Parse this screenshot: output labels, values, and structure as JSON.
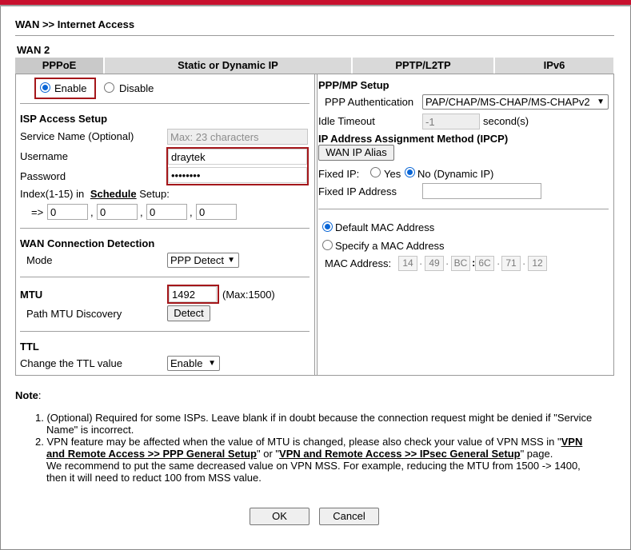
{
  "breadcrumb": "WAN >> Internet Access",
  "wan_label": "WAN 2",
  "tabs": [
    "PPPoE",
    "Static or Dynamic IP",
    "PPTP/L2TP",
    "IPv6"
  ],
  "enable_label": "Enable",
  "disable_label": "Disable",
  "isp": {
    "heading": "ISP Access Setup",
    "service_name_label": "Service Name (Optional)",
    "service_name_placeholder": "Max: 23 characters",
    "username_label": "Username",
    "username_value": "draytek",
    "password_label": "Password",
    "password_value": "••••••••",
    "index_label_pre": "Index(1-15) in",
    "schedule_link": "Schedule",
    "index_label_post": "Setup:",
    "arrow": "=>",
    "schedule_values": [
      "0",
      "0",
      "0",
      "0"
    ],
    "comma": ","
  },
  "detection": {
    "heading": "WAN Connection Detection",
    "mode_label": "Mode",
    "mode_value": "PPP Detect"
  },
  "mtu": {
    "heading": "MTU",
    "value": "1492",
    "max_text": "(Max:1500)",
    "path_label": "Path MTU Discovery",
    "detect_button": "Detect"
  },
  "ttl": {
    "heading": "TTL",
    "change_label": "Change the TTL value",
    "value": "Enable"
  },
  "ppp": {
    "heading": "PPP/MP Setup",
    "auth_label": "PPP Authentication",
    "auth_value": "PAP/CHAP/MS-CHAP/MS-CHAPv2",
    "idle_label": "Idle Timeout",
    "idle_value": "-1",
    "idle_unit": "second(s)"
  },
  "ipcp": {
    "heading": "IP Address Assignment Method (IPCP)",
    "alias_button": "WAN IP Alias",
    "fixed_ip_label": "Fixed IP:",
    "yes_label": "Yes",
    "no_label": "No (Dynamic IP)",
    "fixed_addr_label": "Fixed IP Address"
  },
  "mac": {
    "default_label": "Default MAC Address",
    "specify_label": "Specify a MAC Address",
    "addr_label": "MAC Address:",
    "octets": [
      "14",
      "49",
      "BC",
      "6C",
      "71",
      "12"
    ],
    "dot": "·",
    "colon": ":"
  },
  "notes": {
    "heading": "Note",
    "colon": ":",
    "n1": "1. (Optional) Required for some ISPs. Leave blank if in doubt because the connection request might be denied if \"Service",
    "n1b": "Name\" is incorrect.",
    "n2a": "2. VPN feature may be affected when the value of MTU is changed, please also check your value of VPN MSS in \"",
    "n2_link1a": "VPN",
    "n2_link1b": "and Remote Access >> PPP General Setup",
    "n2_mid": "\" or \"",
    "n2_link2": "VPN and Remote Access >> IPsec General Setup",
    "n2_end": "\" page.",
    "n3": "We recommend to put the same decreased value on VPN MSS. For example, reducing the MTU from 1500 -> 1400,",
    "n4": "then it will need to reduct 100 from MSS value."
  },
  "buttons": {
    "ok": "OK",
    "cancel": "Cancel"
  },
  "colors": {
    "accent_red": "#c8102e",
    "highlight_box": "#a4161a",
    "radio_blue": "#0a66d6"
  }
}
